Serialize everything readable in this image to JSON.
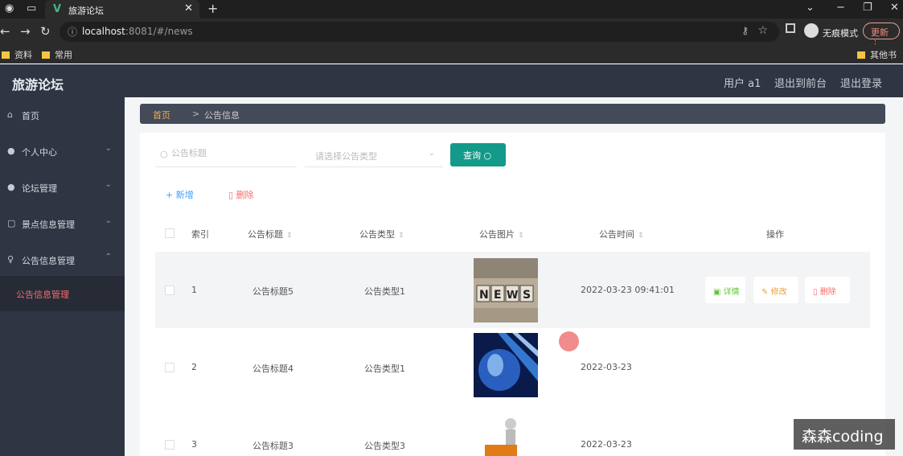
{
  "browser": {
    "tab_title": "旅游论坛",
    "url_host": "localhost",
    "url_path": ":8081/#/news",
    "incognito_label": "无痕模式",
    "update_label": "更新",
    "bookmarks": [
      "资料",
      "常用"
    ],
    "other_bookmarks": "其他书签"
  },
  "header": {
    "app_title": "旅游论坛",
    "user": "用户 a1",
    "back_front": "退出到前台",
    "logout": "退出登录"
  },
  "sidebar": {
    "items": [
      {
        "label": "首页",
        "icon": "home-icon"
      },
      {
        "label": "个人中心",
        "icon": "user-icon"
      },
      {
        "label": "论坛管理",
        "icon": "user-icon"
      },
      {
        "label": "景点信息管理",
        "icon": "document-icon"
      },
      {
        "label": "公告信息管理",
        "icon": "microphone-icon"
      }
    ],
    "active_sub": "公告信息管理"
  },
  "breadcrumb": {
    "home": "首页",
    "separator": ">",
    "current": "公告信息"
  },
  "filters": {
    "title_placeholder": "公告标题",
    "type_placeholder": "请选择公告类型",
    "query_label": "查询"
  },
  "actions": {
    "add": "新增",
    "delete": "删除"
  },
  "table": {
    "headers": {
      "index": "索引",
      "title": "公告标题",
      "type": "公告类型",
      "image": "公告图片",
      "time": "公告时间",
      "ops": "操作"
    },
    "rows": [
      {
        "index": "1",
        "title": "公告标题5",
        "type": "公告类型1",
        "time": "2022-03-23 09:41:01",
        "image": "news-image"
      },
      {
        "index": "2",
        "title": "公告标题4",
        "type": "公告类型1",
        "time": "2022-03-23",
        "image": "globe-image"
      },
      {
        "index": "3",
        "title": "公告标题3",
        "type": "公告类型3",
        "time": "2022-03-23",
        "image": "news-figure-image"
      }
    ],
    "ops": {
      "detail": "详情",
      "edit": "修改",
      "remove": "删除"
    }
  },
  "watermark": "森森coding",
  "colors": {
    "sidebar": "#2f3542",
    "accent": "#139a8a",
    "danger": "#f56c6c",
    "success": "#67c23a",
    "warning": "#e6a23c",
    "primary": "#409eff"
  }
}
